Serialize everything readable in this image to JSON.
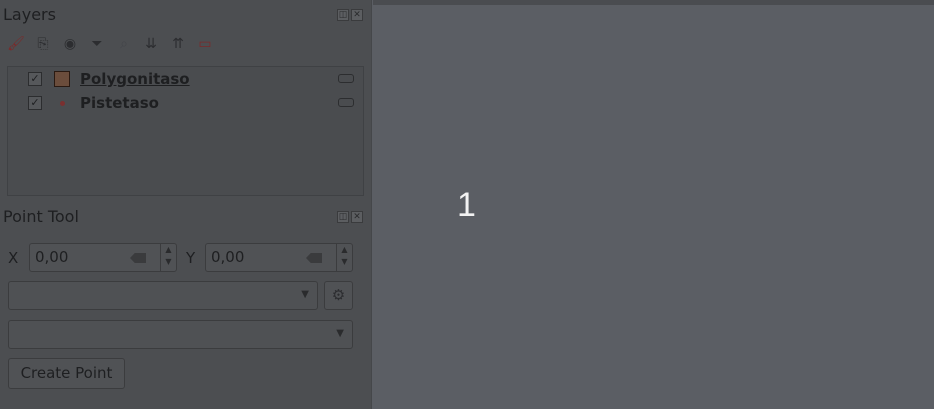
{
  "layers_panel": {
    "title": "Layers",
    "float_label": "◫",
    "close_label": "✕",
    "toolbar_icons": [
      {
        "name": "open-layer-styling-icon",
        "glyph": "🖌"
      },
      {
        "name": "add-group-icon",
        "glyph": "⎘"
      },
      {
        "name": "manage-visibility-icon",
        "glyph": "◉"
      },
      {
        "name": "filter-legend-icon",
        "glyph": "⏷"
      },
      {
        "name": "filter-expression-icon",
        "glyph": "⌕"
      },
      {
        "name": "expand-all-icon",
        "glyph": "⇊"
      },
      {
        "name": "collapse-all-icon",
        "glyph": "⇈"
      },
      {
        "name": "remove-layer-icon",
        "glyph": "▭"
      }
    ],
    "layers": [
      {
        "name": "Polygonitaso",
        "checked": "✓"
      },
      {
        "name": "Pistetaso",
        "checked": "✓"
      }
    ]
  },
  "point_tool": {
    "title": "Point Tool",
    "float_label": "◫",
    "close_label": "✕",
    "x_label": "X",
    "x_value": "0,00",
    "y_label": "Y",
    "y_value": "0,00",
    "spin_up": "▲",
    "spin_down": "▼",
    "combo1_value": "",
    "combo2_value": "",
    "dropdown_glyph": "▼",
    "gear_glyph": "⚙",
    "create_button": "Create Point"
  },
  "map_canvas": {
    "label": "1"
  }
}
